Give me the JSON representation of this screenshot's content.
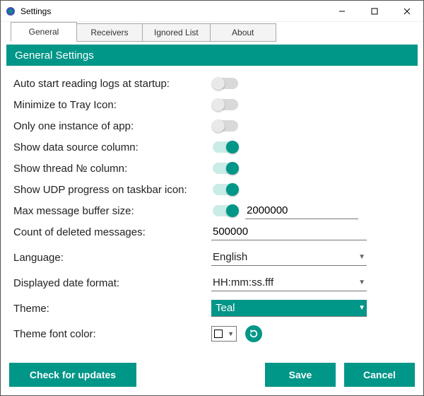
{
  "titlebar": {
    "title": "Settings"
  },
  "tabs": {
    "t0": "General",
    "t1": "Receivers",
    "t2": "Ignored List",
    "t3": "About"
  },
  "section": {
    "title": "General Settings"
  },
  "rows": {
    "auto_start": "Auto start reading logs at startup:",
    "minimize_tray": "Minimize to Tray Icon:",
    "one_instance": "Only one instance of app:",
    "show_source": "Show data source column:",
    "show_thread": "Show thread № column:",
    "show_udp": "Show UDP progress on taskbar icon:",
    "max_buffer": "Max message buffer size:",
    "deleted_count": "Count of deleted messages:",
    "language": "Language:",
    "date_format": "Displayed date format:",
    "theme": "Theme:",
    "theme_font_color": "Theme font color:"
  },
  "values": {
    "max_buffer": "2000000",
    "deleted_count": "500000",
    "language": "English",
    "date_format": "HH:mm:ss.fff",
    "theme": "Teal"
  },
  "toggles": {
    "auto_start": false,
    "minimize_tray": false,
    "one_instance": false,
    "show_source": true,
    "show_thread": true,
    "show_udp": true,
    "max_buffer": true
  },
  "buttons": {
    "check_updates": "Check for updates",
    "save": "Save",
    "cancel": "Cancel"
  },
  "colors": {
    "accent": "#009688"
  }
}
